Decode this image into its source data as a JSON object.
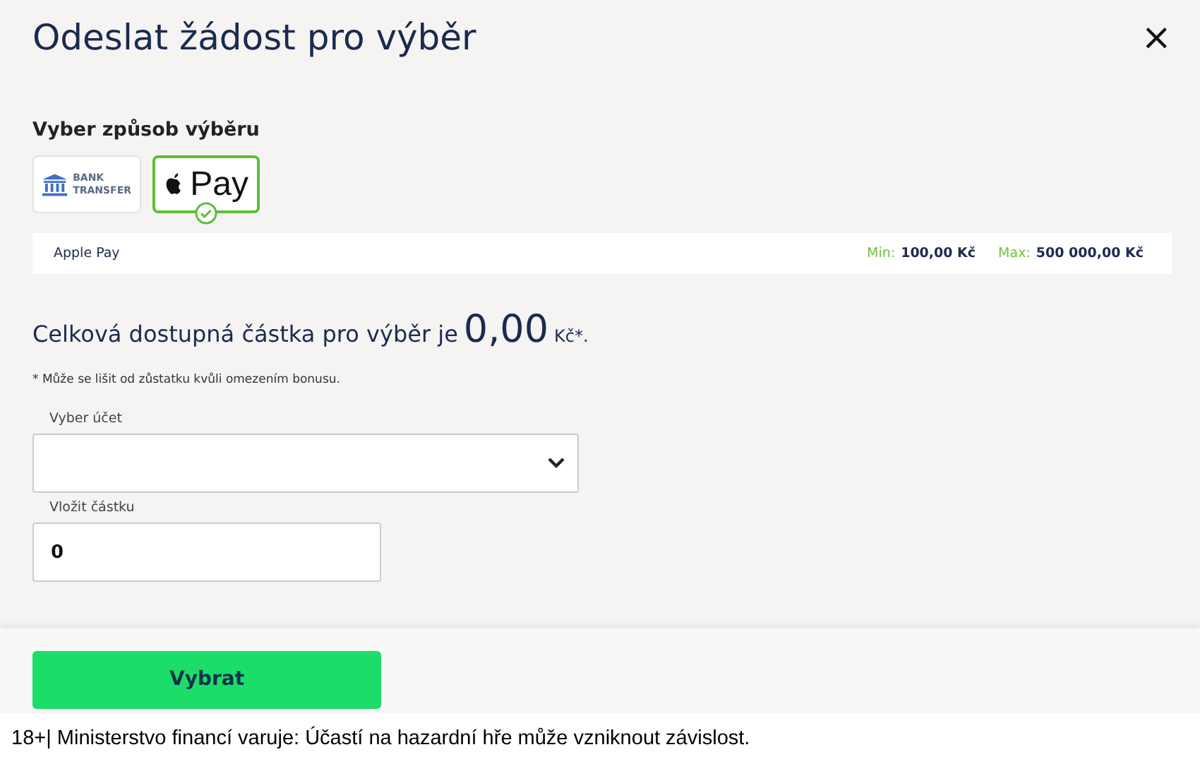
{
  "dialog": {
    "title": "Odeslat žádost pro výběr",
    "close": "×"
  },
  "method_section": {
    "heading": "Vyber způsob výběru",
    "methods": [
      {
        "kind": "bank",
        "lines": [
          "BANK",
          "TRANSFER"
        ],
        "selected": false
      },
      {
        "kind": "applepay",
        "label": "Pay",
        "selected": true
      }
    ],
    "info": {
      "name": "Apple Pay",
      "min_label": "Min:",
      "min_value": "100,00 Kč",
      "max_label": "Max:",
      "max_value": "500 000,00 Kč"
    }
  },
  "available": {
    "text": "Celková dostupná částka pro výběr je",
    "amount": "0,00",
    "currency": "Kč*."
  },
  "note": "* Může se lišit od zůstatku kvůli omezením bonusu.",
  "account_field": {
    "label": "Vyber účet"
  },
  "amount_field": {
    "label": "Vložit částku",
    "value": "0"
  },
  "submit": "Vybrat",
  "disclaimer": "18+| Ministerstvo financí varuje: Účastí na hazardní hře může vzniknout závislost."
}
